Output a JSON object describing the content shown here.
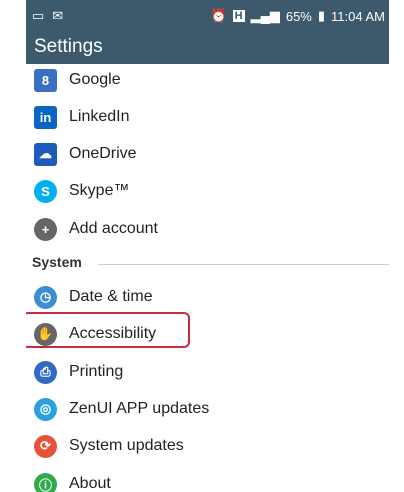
{
  "status_bar": {
    "left_icons": [
      "message-icon",
      "mail-icon"
    ],
    "h_label": "H",
    "battery_percent": "65%",
    "time": "11:04 AM"
  },
  "app_bar": {
    "title": "Settings"
  },
  "accounts": [
    {
      "label": "Google",
      "icon": "google-icon",
      "color": "#3b6fc4"
    },
    {
      "label": "LinkedIn",
      "icon": "linkedin-icon",
      "color": "#0a66c2"
    },
    {
      "label": "OneDrive",
      "icon": "onedrive-icon",
      "color": "#1e5bbd"
    },
    {
      "label": "Skype™",
      "icon": "skype-icon",
      "color": "#00aff0"
    },
    {
      "label": "Add account",
      "icon": "add-icon",
      "color": "#666666"
    }
  ],
  "system": {
    "header": "System",
    "items": [
      {
        "label": "Date & time",
        "icon": "clock-icon",
        "color": "#3c8ed4"
      },
      {
        "label": "Accessibility",
        "icon": "hand-icon",
        "color": "#666666",
        "highlighted": true
      },
      {
        "label": "Printing",
        "icon": "printer-icon",
        "color": "#2f6bc6"
      },
      {
        "label": "ZenUI APP updates",
        "icon": "zenui-icon",
        "color": "#2ba0e0"
      },
      {
        "label": "System updates",
        "icon": "system-update-icon",
        "color": "#e5533b"
      },
      {
        "label": "About",
        "icon": "about-icon",
        "color": "#2faa4c"
      }
    ]
  },
  "colors": {
    "bar": "#3c5a6b",
    "highlight": "#c62d3a"
  }
}
